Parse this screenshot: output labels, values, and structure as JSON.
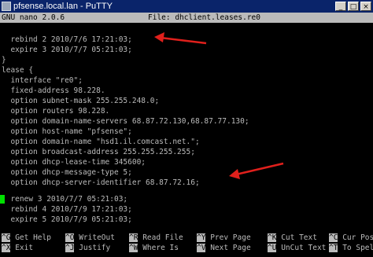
{
  "window": {
    "title": "pfsense.local.lan - PuTTY",
    "controls": [
      "_",
      "□",
      "×"
    ]
  },
  "nano": {
    "version": "GNU nano 2.0.6",
    "file": "File: dhclient.leases.re0"
  },
  "lines": [
    "  rebind 2 2010/7/6 17:21:03;",
    "  expire 3 2010/7/7 05:21:03;",
    "}",
    "lease {",
    "  interface \"re0\";",
    "  fixed-address 98.228.",
    "  option subnet-mask 255.255.248.0;",
    "  option routers 98.228.",
    "  option domain-name-servers 68.87.72.130,68.87.77.130;",
    "  option host-name \"pfsense\";",
    "  option domain-name \"hsd1.il.comcast.net.\";",
    "  option broadcast-address 255.255.255.255;",
    "  option dhcp-lease-time 345600;",
    "  option dhcp-message-type 5;",
    "  option dhcp-server-identifier 68.87.72.16;",
    "  renew 3 2010/7/7 05:21:03;",
    "  rebind 4 2010/7/9 17:21:03;",
    "  expire 5 2010/7/9 05:21:03;"
  ],
  "shortcuts_row1": [
    {
      "key": "^G",
      "label": "Get Help"
    },
    {
      "key": "^O",
      "label": "WriteOut"
    },
    {
      "key": "^R",
      "label": "Read File"
    },
    {
      "key": "^Y",
      "label": "Prev Page"
    },
    {
      "key": "^K",
      "label": "Cut Text"
    },
    {
      "key": "^C",
      "label": "Cur Pos"
    }
  ],
  "shortcuts_row2": [
    {
      "key": "^X",
      "label": "Exit"
    },
    {
      "key": "^J",
      "label": "Justify"
    },
    {
      "key": "^W",
      "label": "Where Is"
    },
    {
      "key": "^V",
      "label": "Next Page"
    },
    {
      "key": "^U",
      "label": "UnCut Text"
    },
    {
      "key": "^T",
      "label": "To Spell"
    }
  ],
  "colors": {
    "titlebar": "#0a246a",
    "terminal_bg": "#000000",
    "terminal_fg": "#bbbbbb",
    "cursor": "#00e000",
    "annotation_arrow": "#e0201c"
  },
  "annotations": [
    "red-arrow-rebind",
    "red-arrow-dhcp-server-identifier"
  ]
}
